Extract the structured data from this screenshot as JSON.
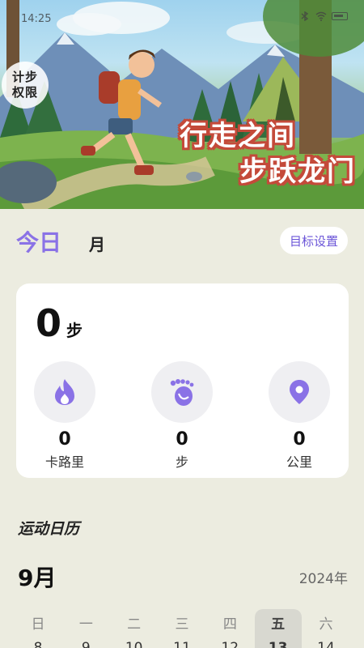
{
  "status_bar": {
    "time": "14:25"
  },
  "banner": {
    "permission_badge": [
      "计步",
      "权限"
    ],
    "slogan_line1": "行走之间",
    "slogan_line2": "步跃龙门"
  },
  "tabs": {
    "today": "今日",
    "month": "月",
    "goal_button": "目标设置"
  },
  "stats": {
    "steps_value": "0",
    "steps_unit": "步",
    "metrics": [
      {
        "icon": "flame-icon",
        "value": "0",
        "label": "卡路里"
      },
      {
        "icon": "footprint-icon",
        "value": "0",
        "label": "步"
      },
      {
        "icon": "location-pin-icon",
        "value": "0",
        "label": "公里"
      }
    ]
  },
  "calendar": {
    "title": "运动日历",
    "month": "9月",
    "year": "2024年",
    "weekdays": [
      "日",
      "一",
      "二",
      "三",
      "四",
      "五",
      "六"
    ],
    "selected_weekday_index": 5,
    "dates_partial": [
      "8",
      "9",
      "10",
      "11",
      "12",
      "13",
      "14"
    ]
  },
  "colors": {
    "accent": "#8A72E6",
    "background": "#ECECE0",
    "card": "#FFFFFF",
    "slogan_outline": "#C44A3A"
  }
}
